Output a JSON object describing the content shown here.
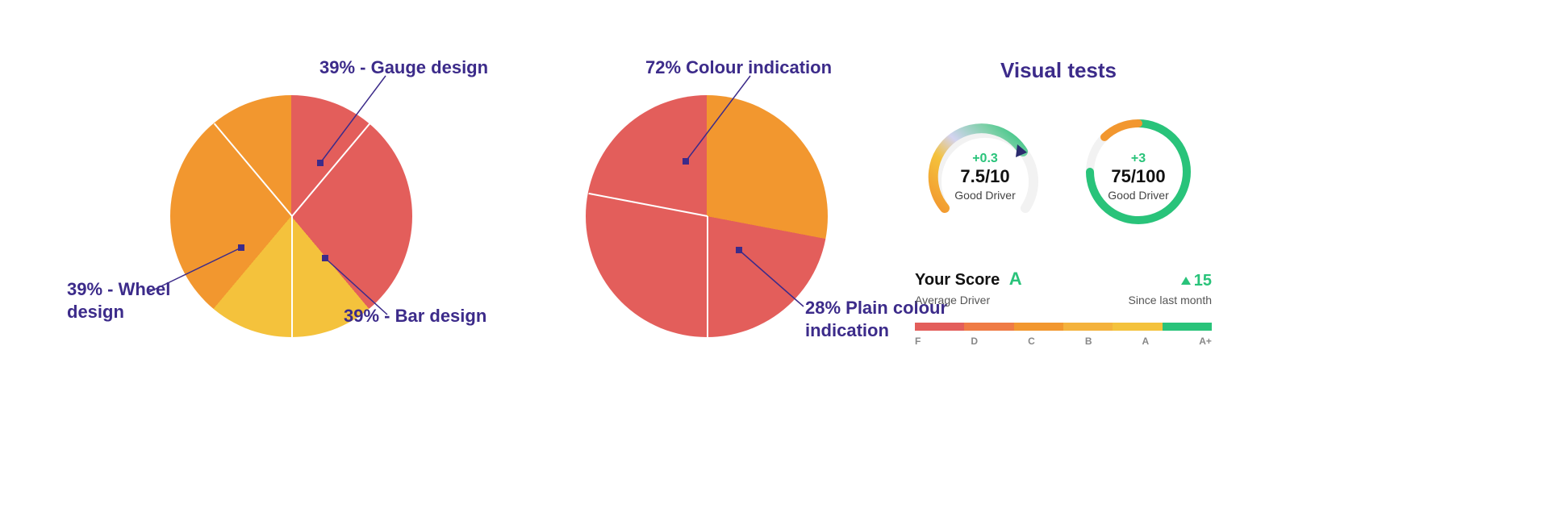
{
  "chart_data": [
    {
      "type": "pie",
      "title": "",
      "series": [
        {
          "name": "Gauge design",
          "value": 39,
          "label": "39% - Gauge design",
          "color": "#e35e5b"
        },
        {
          "name": "Wheel design",
          "value": 39,
          "label": "39% - Wheel design",
          "color": "#f2972f"
        },
        {
          "name": "Bar design",
          "value": 39,
          "label": "39% - Bar design",
          "color": "#f4c23c"
        }
      ]
    },
    {
      "type": "pie",
      "title": "",
      "series": [
        {
          "name": "Colour indication",
          "value": 72,
          "label": "72% Colour indication",
          "color": "#e35e5b"
        },
        {
          "name": "Plain colour indication",
          "value": 28,
          "label": "28% Plain colour indication",
          "color": "#f2972f"
        }
      ]
    }
  ],
  "panel": {
    "title": "Visual tests",
    "gauge1": {
      "delta_label": "+0.3",
      "delta_color": "#29c37a",
      "score": "7.5/10",
      "sub": "Good Driver"
    },
    "gauge2": {
      "delta_label": "+3",
      "delta_color": "#29c37a",
      "score": "75/100",
      "sub": "Good Driver"
    },
    "scorebar": {
      "label": "Your Score",
      "grade": "A",
      "delta": "15",
      "sub_left": "Average Driver",
      "sub_right": "Since last month",
      "ticks": [
        "F",
        "D",
        "C",
        "B",
        "A",
        "A+"
      ],
      "colors": [
        "#e35e5b",
        "#ef7b45",
        "#f2972f",
        "#f4b23c",
        "#f4c23c",
        "#29c37a"
      ]
    }
  }
}
